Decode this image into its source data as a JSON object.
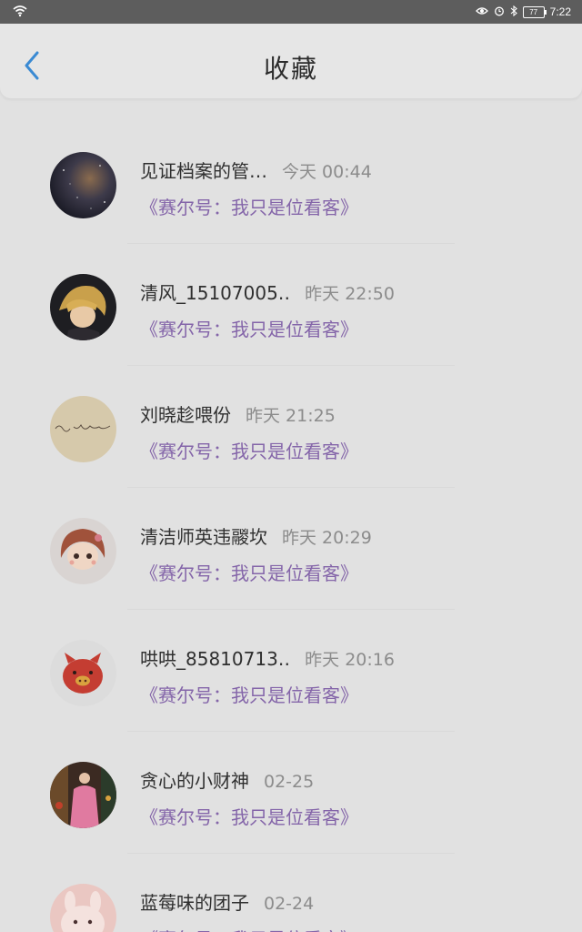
{
  "status_bar": {
    "time": "7:22",
    "battery_level": "77"
  },
  "header": {
    "title": "收藏",
    "back_icon": "chevron-left-icon"
  },
  "colors": {
    "accent": "#3a8ad3",
    "post_title": "#8465a9",
    "time_text": "#8c8c8c",
    "background": "#e1e1e1"
  },
  "favorites": [
    {
      "username": "见证档案的管…",
      "time": "今天 00:44",
      "title": "《赛尔号：我只是位看客》",
      "avatar": "avatar-galaxy"
    },
    {
      "username": "清风_15107005‥",
      "time": "昨天 22:50",
      "title": "《赛尔号：我只是位看客》",
      "avatar": "avatar-anime-girl"
    },
    {
      "username": "刘晓趁喂份",
      "time": "昨天 21:25",
      "title": "《赛尔号：我只是位看客》",
      "avatar": "avatar-handwriting"
    },
    {
      "username": "清洁师英违鬷坎",
      "time": "昨天 20:29",
      "title": "《赛尔号：我只是位看客》",
      "avatar": "avatar-cartoon-girl"
    },
    {
      "username": "哄哄_85810713‥",
      "time": "昨天 20:16",
      "title": "《赛尔号：我只是位看客》",
      "avatar": "avatar-red-pig"
    },
    {
      "username": "贪心的小财神",
      "time": "02-25",
      "title": "《赛尔号：我只是位看客》",
      "avatar": "avatar-pink-figure"
    },
    {
      "username": "蓝莓味的团子",
      "time": "02-24",
      "title": "《赛尔号：我只是位看客》",
      "avatar": "avatar-pink-bunny"
    }
  ]
}
